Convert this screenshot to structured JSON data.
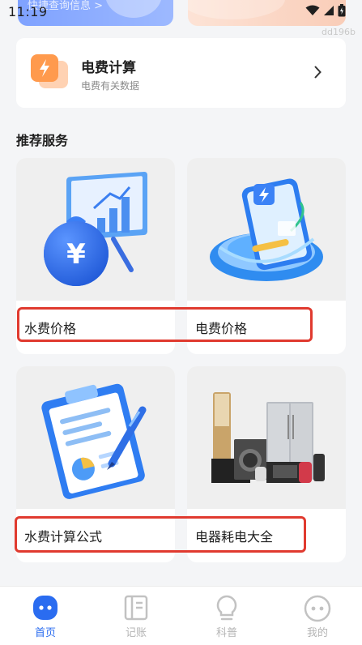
{
  "status_bar": {
    "time": "11:19",
    "watermark": "dd196b"
  },
  "top_cards": {
    "left_link": "快捷查询信息 >"
  },
  "feature": {
    "title": "电费计算",
    "subtitle": "电费有关数据"
  },
  "section": {
    "title": "推荐服务"
  },
  "services": [
    {
      "label": "水费价格"
    },
    {
      "label": "电费价格"
    },
    {
      "label": "水费计算公式"
    },
    {
      "label": "电器耗电大全"
    }
  ],
  "tabbar": {
    "items": [
      {
        "label": "首页",
        "icon": "home-face-icon",
        "active": true
      },
      {
        "label": "记账",
        "icon": "notebook-icon",
        "active": false
      },
      {
        "label": "科普",
        "icon": "lightbulb-icon",
        "active": false
      },
      {
        "label": "我的",
        "icon": "profile-face-icon",
        "active": false
      }
    ]
  },
  "colors": {
    "accent": "#2a6cf0",
    "highlight": "#e03a2f",
    "background": "#f4f5f7"
  }
}
